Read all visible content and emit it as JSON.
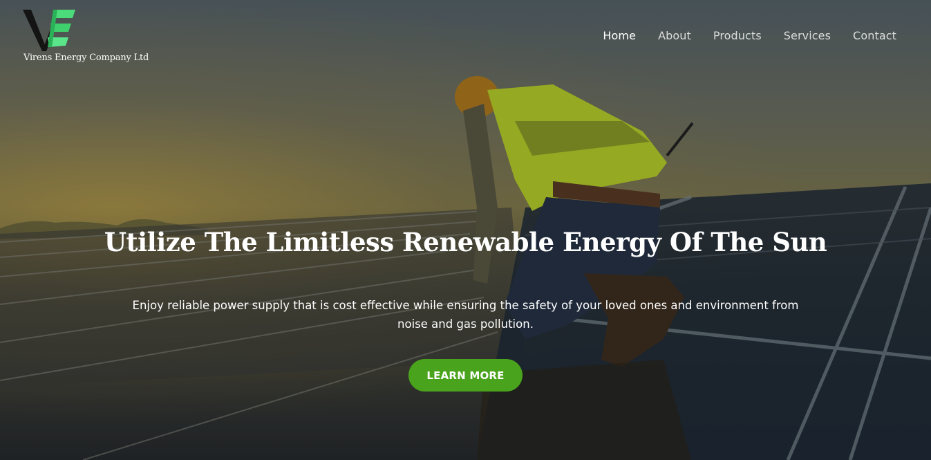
{
  "brand": {
    "name": "Virens Energy Company Ltd",
    "logo_icon": "virens-ve-logo",
    "logo_colors": [
      "#1a1a1a",
      "#4cdb7a"
    ]
  },
  "nav": {
    "items": [
      {
        "label": "Home",
        "active": true
      },
      {
        "label": "About",
        "active": false
      },
      {
        "label": "Products",
        "active": false
      },
      {
        "label": "Services",
        "active": false
      },
      {
        "label": "Contact",
        "active": false
      }
    ]
  },
  "hero": {
    "headline": "Utilize The Limitless Renewable Energy Of The Sun",
    "subtext": "Enjoy reliable power supply that is cost effective while ensuring the safety of your loved ones and environment from noise and gas pollution.",
    "cta_label": "LEARN MORE",
    "cta_color": "#4aa31c",
    "background_image": "worker-on-solar-panels-photo"
  }
}
